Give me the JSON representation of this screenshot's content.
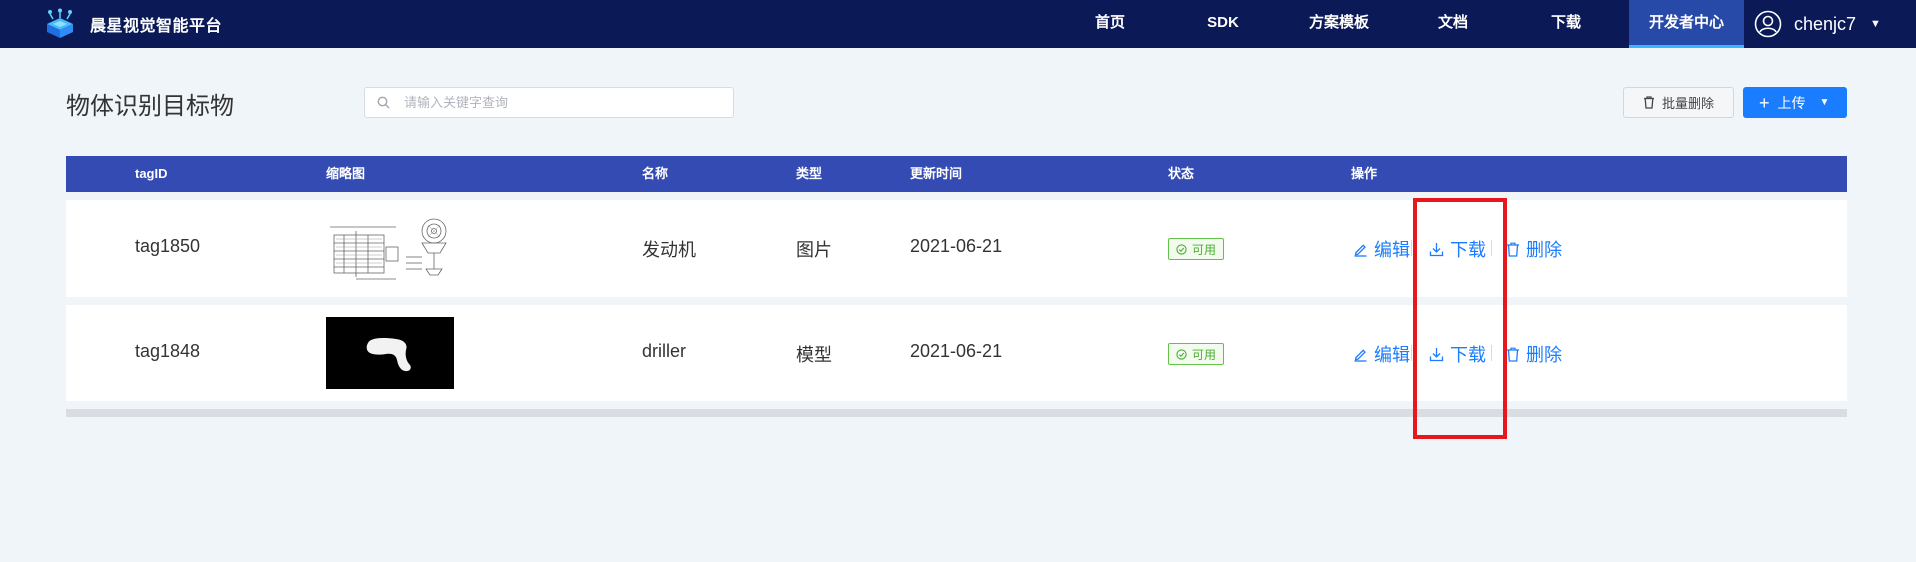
{
  "header": {
    "brand": "晨星视觉智能平台",
    "nav": [
      {
        "label": "首页",
        "active": false
      },
      {
        "label": "SDK",
        "active": false
      },
      {
        "label": "方案模板",
        "active": false
      },
      {
        "label": "文档",
        "active": false
      },
      {
        "label": "下载",
        "active": false
      },
      {
        "label": "开发者中心",
        "active": true
      }
    ],
    "user": "chenjc7"
  },
  "toolbar": {
    "title": "物体识别目标物",
    "search_placeholder": "请输入关键字查询",
    "batch_delete_label": "批量删除",
    "upload_label": "上传"
  },
  "table": {
    "columns": [
      "tagID",
      "缩略图",
      "名称",
      "类型",
      "更新时间",
      "状态",
      "操作"
    ],
    "rows": [
      {
        "tag_id": "tag1850",
        "name": "发动机",
        "type": "图片",
        "updated": "2021-06-21",
        "status": "可用",
        "thumbnail": "engine-drawing"
      },
      {
        "tag_id": "tag1848",
        "name": "driller",
        "type": "模型",
        "updated": "2021-06-21",
        "status": "可用",
        "thumbnail": "driller-silhouette"
      }
    ],
    "actions": {
      "edit": "编辑",
      "download": "下载",
      "delete": "删除"
    }
  },
  "colors": {
    "header_bg": "#0b1a57",
    "nav_active_bg": "#2749a8",
    "table_header_bg": "#344bb3",
    "primary": "#1a7dff",
    "status_green": "#4aae30",
    "highlight_red": "#e6171d"
  }
}
